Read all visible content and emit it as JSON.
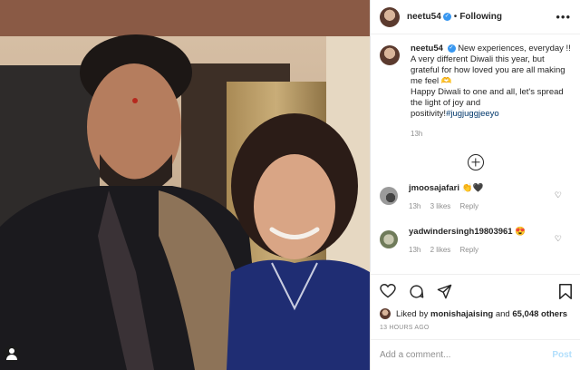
{
  "post": {
    "username": "neetu54",
    "separator": "•",
    "follow_status": "Following",
    "more_glyph": "•••"
  },
  "caption": {
    "username": "neetu54",
    "text_1": "New experiences, everyday !! A very different Diwali this year, but grateful for how loved you are all making me feel 🫶",
    "text_2": "Happy Diwali to one and all, let's spread the light of joy and positivity!",
    "hashtag": "#jugjuggjeeyo",
    "time": "13h"
  },
  "comments": [
    {
      "username": "jmoosajafari",
      "text": "👏🖤",
      "time": "13h",
      "likes": "3 likes",
      "reply": "Reply"
    },
    {
      "username": "yadwindersingh19803961",
      "text": "😍",
      "time": "13h",
      "likes": "2 likes",
      "reply": "Reply"
    }
  ],
  "likes": {
    "prefix": "Liked by",
    "user": "monishajaising",
    "connector": "and",
    "others": "65,048 others"
  },
  "time_ago": "13 HOURS AGO",
  "add_comment": {
    "placeholder": "Add a comment...",
    "post_label": "Post"
  },
  "colors": {
    "accent": "#3897f0",
    "hashtag": "#00376b",
    "muted": "#8e8e8e"
  }
}
